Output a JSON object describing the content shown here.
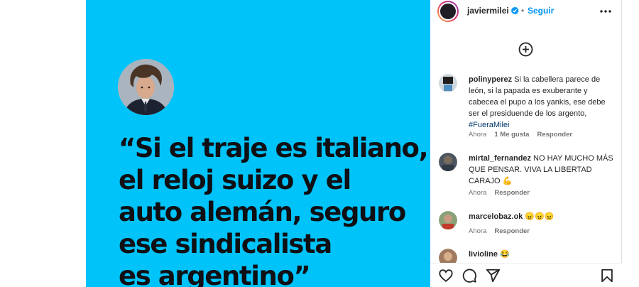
{
  "post": {
    "quote_lines": [
      "“Si el traje es italiano,",
      "el reloj suizo y el",
      "auto alemán, seguro",
      "ese sindicalista",
      "es argentino”"
    ],
    "background_color": "#00c3f9"
  },
  "header": {
    "username": "javiermilei",
    "separator": "•",
    "follow_label": "Seguir",
    "verified": true
  },
  "comments": [
    {
      "user": "polinyperez",
      "text": "Si la cabellera parece de león, si la papada es exuberante y cabecea el pupo a los yankis, ese debe ser el presiduende de los argento,",
      "hashtag": "#FueraMilei",
      "time": "Ahora",
      "likes": "1 Me gusta",
      "reply": "Responder"
    },
    {
      "user": "mirtal_fernandez",
      "text": "NO HAY MUCHO MÁS QUE PENSAR. VIVA LA LIBERTAD CARAJO 💪",
      "time": "Ahora",
      "reply": "Responder"
    },
    {
      "user": "marcelobaz.ok",
      "text": "😠😠😠",
      "time": "Ahora",
      "reply": "Responder"
    },
    {
      "user": "livioline",
      "text": "😂"
    }
  ],
  "icons": {
    "add": "plus-circle-icon",
    "more": "more-horizontal-icon",
    "like": "heart-icon",
    "comment": "comment-icon",
    "share": "share-icon",
    "save": "bookmark-icon"
  }
}
